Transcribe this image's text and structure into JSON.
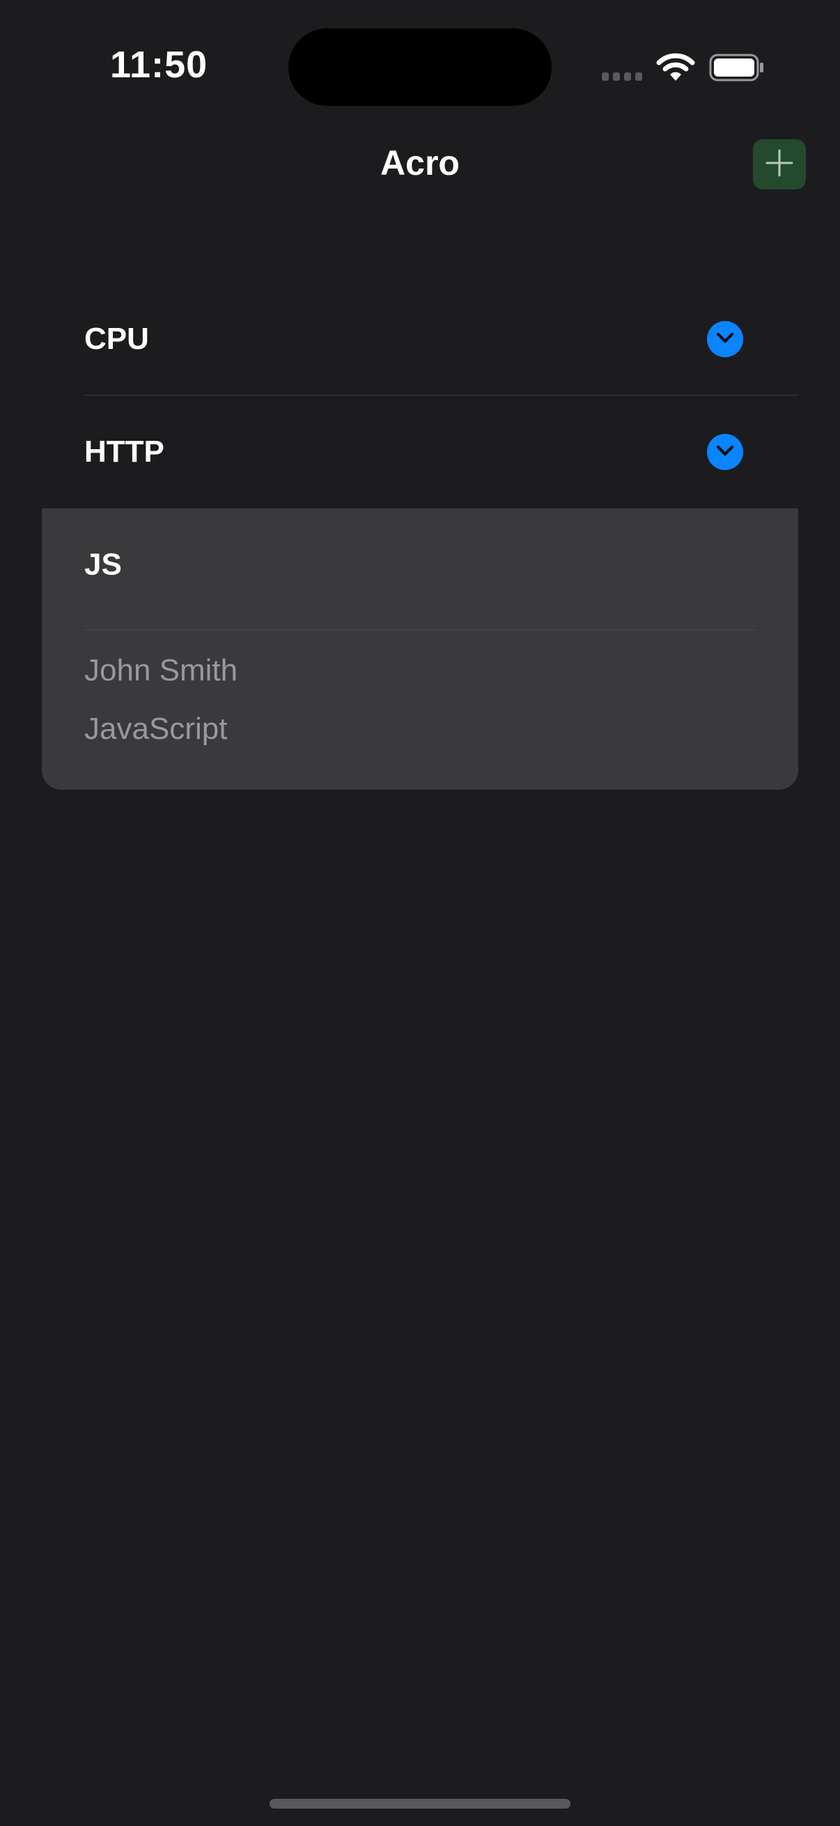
{
  "status_bar": {
    "time": "11:50",
    "icons": [
      "cellular-signal-icon",
      "wifi-icon",
      "battery-icon"
    ]
  },
  "nav": {
    "title": "Acro",
    "add_button_icon": "plus-icon",
    "add_button_color": "#234a2c"
  },
  "acronyms": [
    {
      "label": "CPU",
      "expanded": false
    },
    {
      "label": "HTTP",
      "expanded": false
    },
    {
      "label": "JS",
      "expanded": true,
      "details": [
        "John Smith",
        "JavaScript"
      ]
    }
  ],
  "colors": {
    "background": "#1c1c1e",
    "expanded_card": "#3a3a3c",
    "accent": "#0a84ff"
  }
}
